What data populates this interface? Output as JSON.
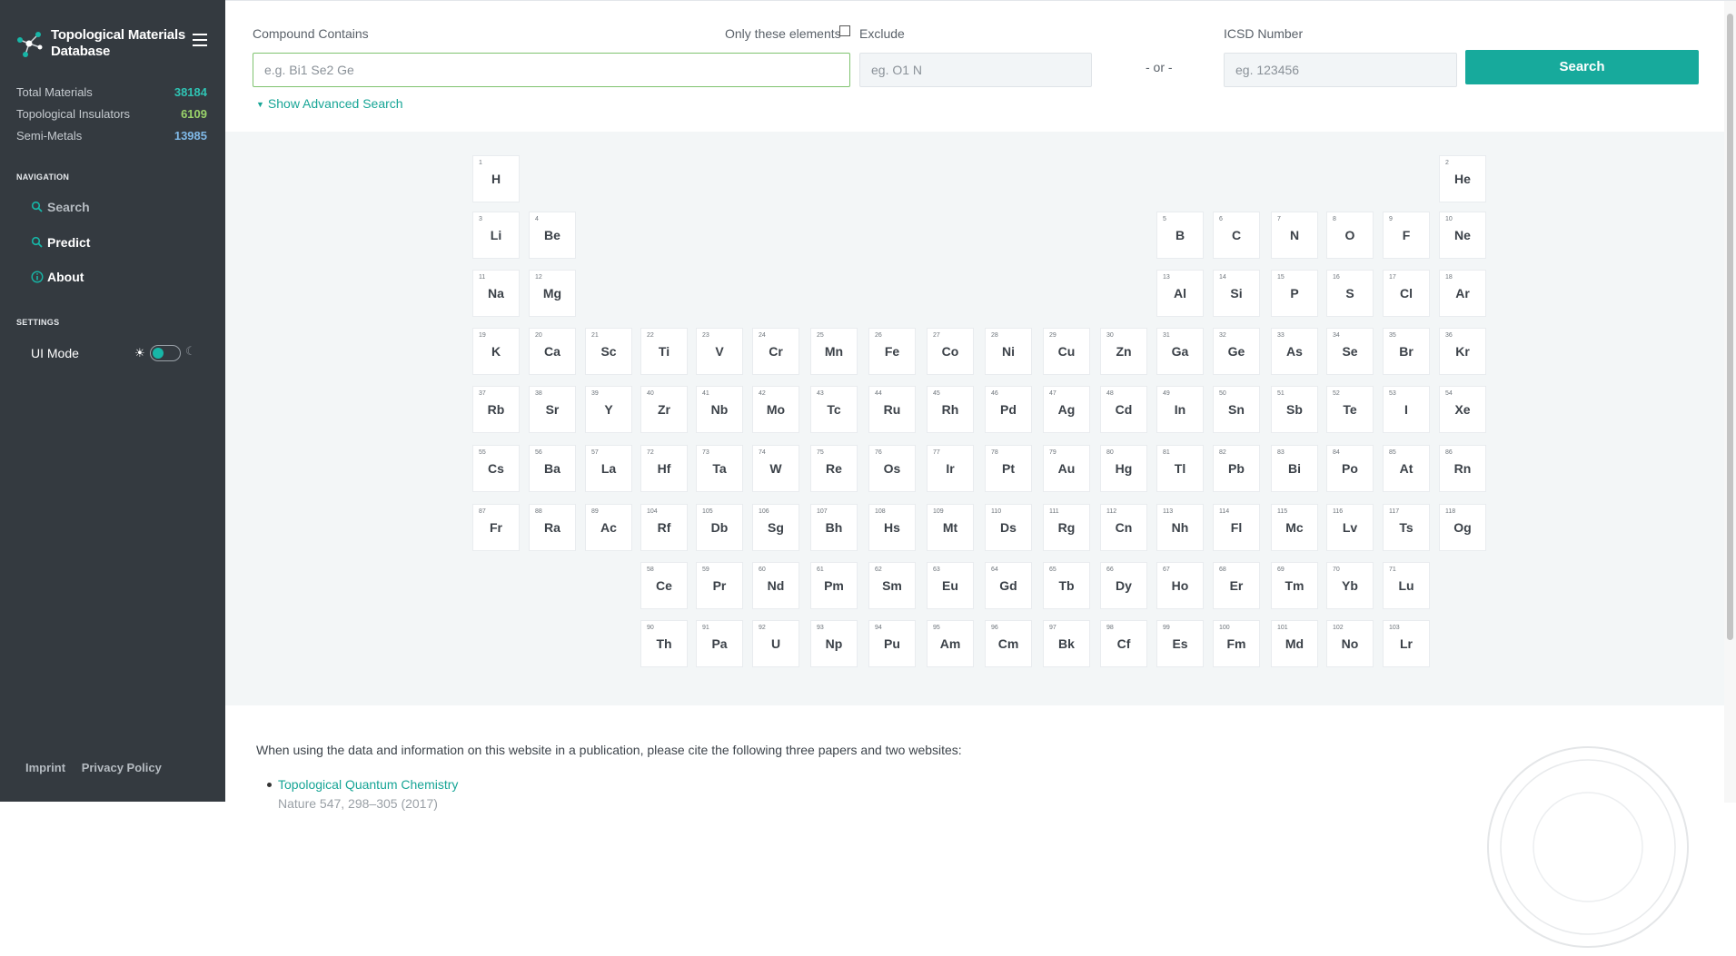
{
  "sidebar": {
    "brand_title": "Topological Materials Database",
    "stats": [
      {
        "label": "Total Materials",
        "value": "38184",
        "color": "#2fc3b3"
      },
      {
        "label": "Topological Insulators",
        "value": "6109",
        "color": "#9ad36a"
      },
      {
        "label": "Semi-Metals",
        "value": "13985",
        "color": "#7fb8e6"
      }
    ],
    "navigation_heading": "NAVIGATION",
    "nav": [
      {
        "label": "Search",
        "icon": "search-icon"
      },
      {
        "label": "Predict",
        "icon": "search-icon"
      },
      {
        "label": "About",
        "icon": "info-icon"
      }
    ],
    "settings_heading": "SETTINGS",
    "ui_mode_label": "UI Mode",
    "footer": {
      "imprint": "Imprint",
      "privacy": "Privacy Policy"
    }
  },
  "search": {
    "compound_label": "Compound Contains",
    "compound_placeholder": "e.g. Bi1 Se2 Ge",
    "only_these_label": "Only these elements",
    "exclude_label": "Exclude",
    "exclude_placeholder": "eg. O1 N",
    "or_text": "- or -",
    "icsd_label": "ICSD Number",
    "icsd_placeholder": "eg. 123456",
    "button_label": "Search",
    "advanced_label": "Show Advanced Search"
  },
  "elements": [
    {
      "n": "1",
      "s": "H"
    },
    {
      "n": "2",
      "s": "He"
    },
    {
      "n": "3",
      "s": "Li"
    },
    {
      "n": "4",
      "s": "Be"
    },
    {
      "n": "5",
      "s": "B"
    },
    {
      "n": "6",
      "s": "C"
    },
    {
      "n": "7",
      "s": "N"
    },
    {
      "n": "8",
      "s": "O"
    },
    {
      "n": "9",
      "s": "F"
    },
    {
      "n": "10",
      "s": "Ne"
    },
    {
      "n": "11",
      "s": "Na"
    },
    {
      "n": "12",
      "s": "Mg"
    },
    {
      "n": "13",
      "s": "Al"
    },
    {
      "n": "14",
      "s": "Si"
    },
    {
      "n": "15",
      "s": "P"
    },
    {
      "n": "16",
      "s": "S"
    },
    {
      "n": "17",
      "s": "Cl"
    },
    {
      "n": "18",
      "s": "Ar"
    },
    {
      "n": "19",
      "s": "K"
    },
    {
      "n": "20",
      "s": "Ca"
    },
    {
      "n": "21",
      "s": "Sc"
    },
    {
      "n": "22",
      "s": "Ti"
    },
    {
      "n": "23",
      "s": "V"
    },
    {
      "n": "24",
      "s": "Cr"
    },
    {
      "n": "25",
      "s": "Mn"
    },
    {
      "n": "26",
      "s": "Fe"
    },
    {
      "n": "27",
      "s": "Co"
    },
    {
      "n": "28",
      "s": "Ni"
    },
    {
      "n": "29",
      "s": "Cu"
    },
    {
      "n": "30",
      "s": "Zn"
    },
    {
      "n": "31",
      "s": "Ga"
    },
    {
      "n": "32",
      "s": "Ge"
    },
    {
      "n": "33",
      "s": "As"
    },
    {
      "n": "34",
      "s": "Se"
    },
    {
      "n": "35",
      "s": "Br"
    },
    {
      "n": "36",
      "s": "Kr"
    },
    {
      "n": "37",
      "s": "Rb"
    },
    {
      "n": "38",
      "s": "Sr"
    },
    {
      "n": "39",
      "s": "Y"
    },
    {
      "n": "40",
      "s": "Zr"
    },
    {
      "n": "41",
      "s": "Nb"
    },
    {
      "n": "42",
      "s": "Mo"
    },
    {
      "n": "43",
      "s": "Tc"
    },
    {
      "n": "44",
      "s": "Ru"
    },
    {
      "n": "45",
      "s": "Rh"
    },
    {
      "n": "46",
      "s": "Pd"
    },
    {
      "n": "47",
      "s": "Ag"
    },
    {
      "n": "48",
      "s": "Cd"
    },
    {
      "n": "49",
      "s": "In"
    },
    {
      "n": "50",
      "s": "Sn"
    },
    {
      "n": "51",
      "s": "Sb"
    },
    {
      "n": "52",
      "s": "Te"
    },
    {
      "n": "53",
      "s": "I"
    },
    {
      "n": "54",
      "s": "Xe"
    },
    {
      "n": "55",
      "s": "Cs"
    },
    {
      "n": "56",
      "s": "Ba"
    },
    {
      "n": "57",
      "s": "La"
    },
    {
      "n": "72",
      "s": "Hf"
    },
    {
      "n": "73",
      "s": "Ta"
    },
    {
      "n": "74",
      "s": "W"
    },
    {
      "n": "75",
      "s": "Re"
    },
    {
      "n": "76",
      "s": "Os"
    },
    {
      "n": "77",
      "s": "Ir"
    },
    {
      "n": "78",
      "s": "Pt"
    },
    {
      "n": "79",
      "s": "Au"
    },
    {
      "n": "80",
      "s": "Hg"
    },
    {
      "n": "81",
      "s": "Tl"
    },
    {
      "n": "82",
      "s": "Pb"
    },
    {
      "n": "83",
      "s": "Bi"
    },
    {
      "n": "84",
      "s": "Po"
    },
    {
      "n": "85",
      "s": "At"
    },
    {
      "n": "86",
      "s": "Rn"
    },
    {
      "n": "87",
      "s": "Fr"
    },
    {
      "n": "88",
      "s": "Ra"
    },
    {
      "n": "89",
      "s": "Ac"
    },
    {
      "n": "104",
      "s": "Rf"
    },
    {
      "n": "105",
      "s": "Db"
    },
    {
      "n": "106",
      "s": "Sg"
    },
    {
      "n": "107",
      "s": "Bh"
    },
    {
      "n": "108",
      "s": "Hs"
    },
    {
      "n": "109",
      "s": "Mt"
    },
    {
      "n": "110",
      "s": "Ds"
    },
    {
      "n": "111",
      "s": "Rg"
    },
    {
      "n": "112",
      "s": "Cn"
    },
    {
      "n": "113",
      "s": "Nh"
    },
    {
      "n": "114",
      "s": "Fl"
    },
    {
      "n": "115",
      "s": "Mc"
    },
    {
      "n": "116",
      "s": "Lv"
    },
    {
      "n": "117",
      "s": "Ts"
    },
    {
      "n": "118",
      "s": "Og"
    },
    {
      "n": "58",
      "s": "Ce"
    },
    {
      "n": "59",
      "s": "Pr"
    },
    {
      "n": "60",
      "s": "Nd"
    },
    {
      "n": "61",
      "s": "Pm"
    },
    {
      "n": "62",
      "s": "Sm"
    },
    {
      "n": "63",
      "s": "Eu"
    },
    {
      "n": "64",
      "s": "Gd"
    },
    {
      "n": "65",
      "s": "Tb"
    },
    {
      "n": "66",
      "s": "Dy"
    },
    {
      "n": "67",
      "s": "Ho"
    },
    {
      "n": "68",
      "s": "Er"
    },
    {
      "n": "69",
      "s": "Tm"
    },
    {
      "n": "70",
      "s": "Yb"
    },
    {
      "n": "71",
      "s": "Lu"
    },
    {
      "n": "90",
      "s": "Th"
    },
    {
      "n": "91",
      "s": "Pa"
    },
    {
      "n": "92",
      "s": "U"
    },
    {
      "n": "93",
      "s": "Np"
    },
    {
      "n": "94",
      "s": "Pu"
    },
    {
      "n": "95",
      "s": "Am"
    },
    {
      "n": "96",
      "s": "Cm"
    },
    {
      "n": "97",
      "s": "Bk"
    },
    {
      "n": "98",
      "s": "Cf"
    },
    {
      "n": "99",
      "s": "Es"
    },
    {
      "n": "100",
      "s": "Fm"
    },
    {
      "n": "101",
      "s": "Md"
    },
    {
      "n": "102",
      "s": "No"
    },
    {
      "n": "103",
      "s": "Lr"
    }
  ],
  "citation": {
    "intro": "When using the data and information on this website in a publication, please cite the following three papers and two websites:",
    "first_link": "Topological Quantum Chemistry",
    "next_line_peek": "Nature 547, 298–305 (2017)"
  },
  "colors": {
    "accent": "#17aa9c",
    "sidebar_bg": "#343a40"
  }
}
